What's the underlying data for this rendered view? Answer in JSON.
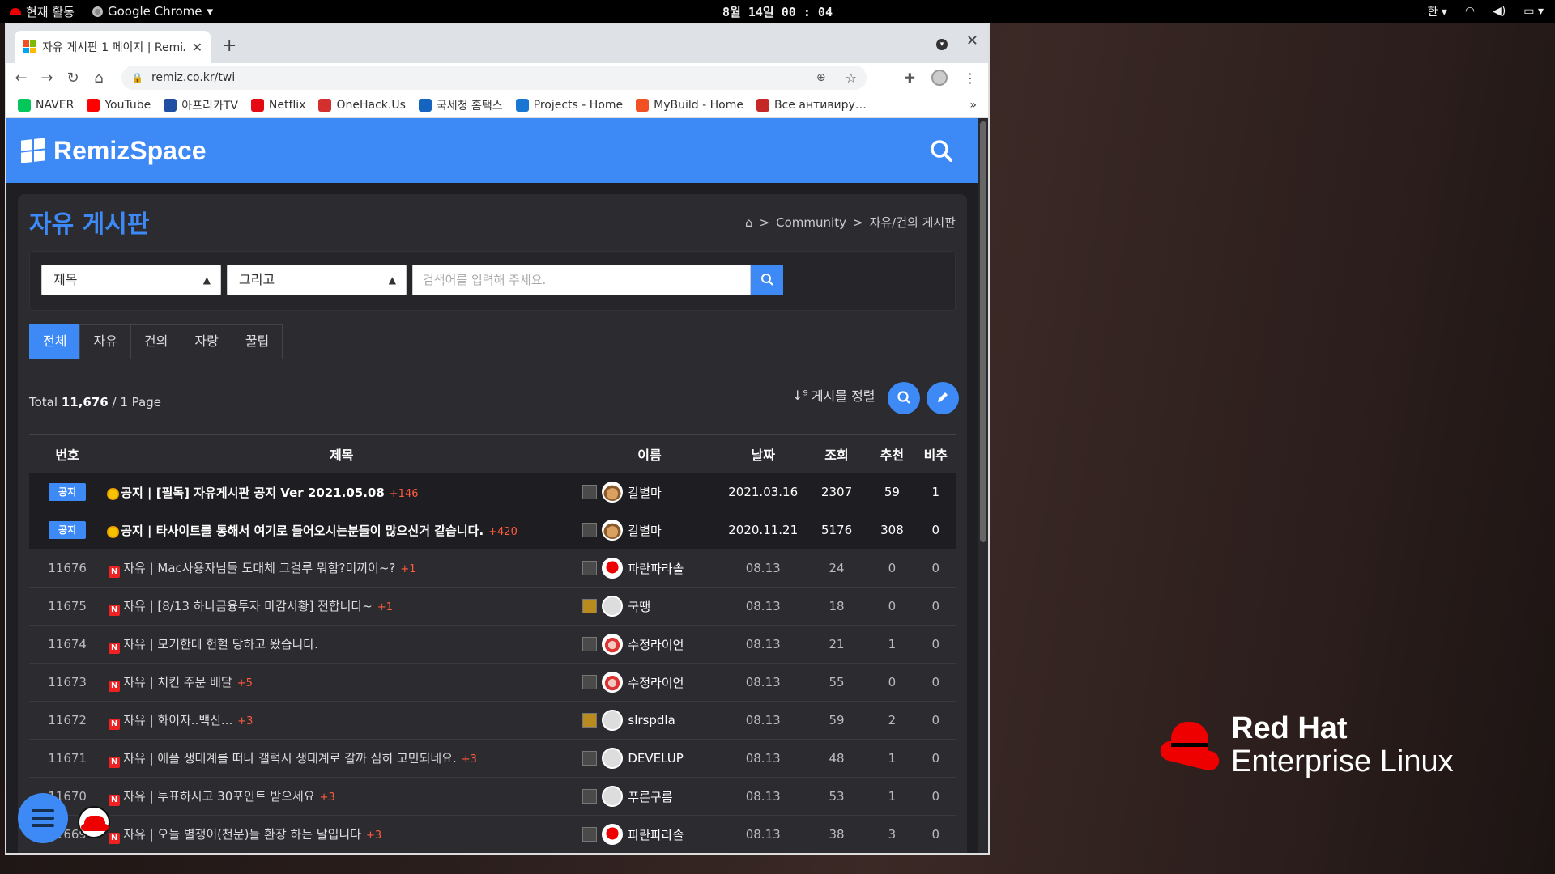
{
  "system_bar": {
    "activities": "현재 활동",
    "app_name": "Google Chrome",
    "clock": "8월 14일  00 : 04",
    "ime": "한"
  },
  "desktop_logo": {
    "line1": "Red Hat",
    "line2": "Enterprise Linux"
  },
  "browser": {
    "tab_title": "자유 게시판 1 페이지 | Remiz",
    "url": "remiz.co.kr/twi",
    "bookmarks": [
      {
        "label": "NAVER",
        "color": "#03c75a",
        "glyph": "N"
      },
      {
        "label": "YouTube",
        "color": "#ff0000",
        "glyph": "▶"
      },
      {
        "label": "아프리카TV",
        "color": "#1f4fa3",
        "glyph": "A"
      },
      {
        "label": "Netflix",
        "color": "#e50914",
        "glyph": "N"
      },
      {
        "label": "OneHack.Us",
        "color": "#d32f2f",
        "glyph": "1H"
      },
      {
        "label": "국세청 홈택스",
        "color": "#1565c0",
        "glyph": "H"
      },
      {
        "label": "Projects - Home",
        "color": "#1976d2",
        "glyph": "P"
      },
      {
        "label": "MyBuild - Home",
        "color": "#f25022",
        "glyph": "M"
      },
      {
        "label": "Все антивиру…",
        "color": "#c62828",
        "glyph": "A"
      }
    ],
    "more_label": "»"
  },
  "site": {
    "logo_text": "RemizSpace",
    "board_title": "자유 게시판",
    "breadcrumb": {
      "community": "Community",
      "current": "자유/건의 게시판"
    },
    "search": {
      "field_select": "제목",
      "logic_select": "그리고",
      "placeholder": "검색어를 입력해 주세요."
    },
    "tabs": [
      "전체",
      "자유",
      "건의",
      "자랑",
      "꿀팁"
    ],
    "total_prefix": "Total",
    "total_count": "11,676",
    "total_suffix": "/ 1 Page",
    "sort_label": "게시물 정렬",
    "table": {
      "headers": [
        "번호",
        "제목",
        "이름",
        "날짜",
        "조회",
        "추천",
        "비추"
      ],
      "rows": [
        {
          "no": "공지",
          "notice": true,
          "subject": "공지 | [필독] 자유게시판 공지 Ver 2021.05.08",
          "comments": "+146",
          "author": "칼별마",
          "avatar": "cat",
          "level": "normal",
          "date": "2021.03.16",
          "views": "2307",
          "up": "59",
          "down": "1"
        },
        {
          "no": "공지",
          "notice": true,
          "subject": "공지 | 타사이트를 통해서 여기로 들어오시는분들이 많으신거 같습니다.",
          "comments": "+420",
          "author": "칼별마",
          "avatar": "cat",
          "level": "normal",
          "date": "2020.11.21",
          "views": "5176",
          "up": "308",
          "down": "0"
        },
        {
          "no": "11676",
          "notice": false,
          "subject": "자유 | Mac사용자님들 도대체 그걸루 뭐함?미끼이~?",
          "comments": "+1",
          "author": "파란파라솔",
          "avatar": "hat",
          "level": "normal",
          "date": "08.13",
          "views": "24",
          "up": "0",
          "down": "0"
        },
        {
          "no": "11675",
          "notice": false,
          "subject": "자유 | [8/13 하나금융투자 마감시황] 전합니다~",
          "comments": "+1",
          "author": "국땡",
          "avatar": "blank",
          "level": "gold",
          "date": "08.13",
          "views": "18",
          "up": "0",
          "down": "0"
        },
        {
          "no": "11674",
          "notice": false,
          "subject": "자유 | 모기한테 헌혈 당하고 왔습니다.",
          "comments": "",
          "author": "수정라이언",
          "avatar": "girl",
          "level": "normal",
          "date": "08.13",
          "views": "21",
          "up": "1",
          "down": "0"
        },
        {
          "no": "11673",
          "notice": false,
          "subject": "자유 | 치킨 주문 배달",
          "comments": "+5",
          "author": "수정라이언",
          "avatar": "girl",
          "level": "normal",
          "date": "08.13",
          "views": "55",
          "up": "0",
          "down": "0"
        },
        {
          "no": "11672",
          "notice": false,
          "subject": "자유 | 화이자..백신...",
          "comments": "+3",
          "author": "slrspdla",
          "avatar": "blank",
          "level": "gold",
          "date": "08.13",
          "views": "59",
          "up": "2",
          "down": "0"
        },
        {
          "no": "11671",
          "notice": false,
          "subject": "자유 | 애플 생태계를 떠나 갤럭시 생태계로 갈까 심히 고민되네요.",
          "comments": "+3",
          "author": "DEVELUP",
          "avatar": "blank",
          "level": "normal",
          "date": "08.13",
          "views": "48",
          "up": "1",
          "down": "0"
        },
        {
          "no": "11670",
          "notice": false,
          "subject": "자유 | 투표하시고 30포인트 받으세요",
          "comments": "+3",
          "author": "푸른구름",
          "avatar": "blank",
          "level": "normal",
          "date": "08.13",
          "views": "53",
          "up": "1",
          "down": "0"
        },
        {
          "no": "11669",
          "notice": false,
          "subject": "자유 | 오늘 별쟁이(천문)들 환장 하는 날입니다",
          "comments": "+3",
          "author": "파란파라솔",
          "avatar": "hat",
          "level": "normal",
          "date": "08.13",
          "views": "38",
          "up": "3",
          "down": "0"
        }
      ]
    }
  }
}
